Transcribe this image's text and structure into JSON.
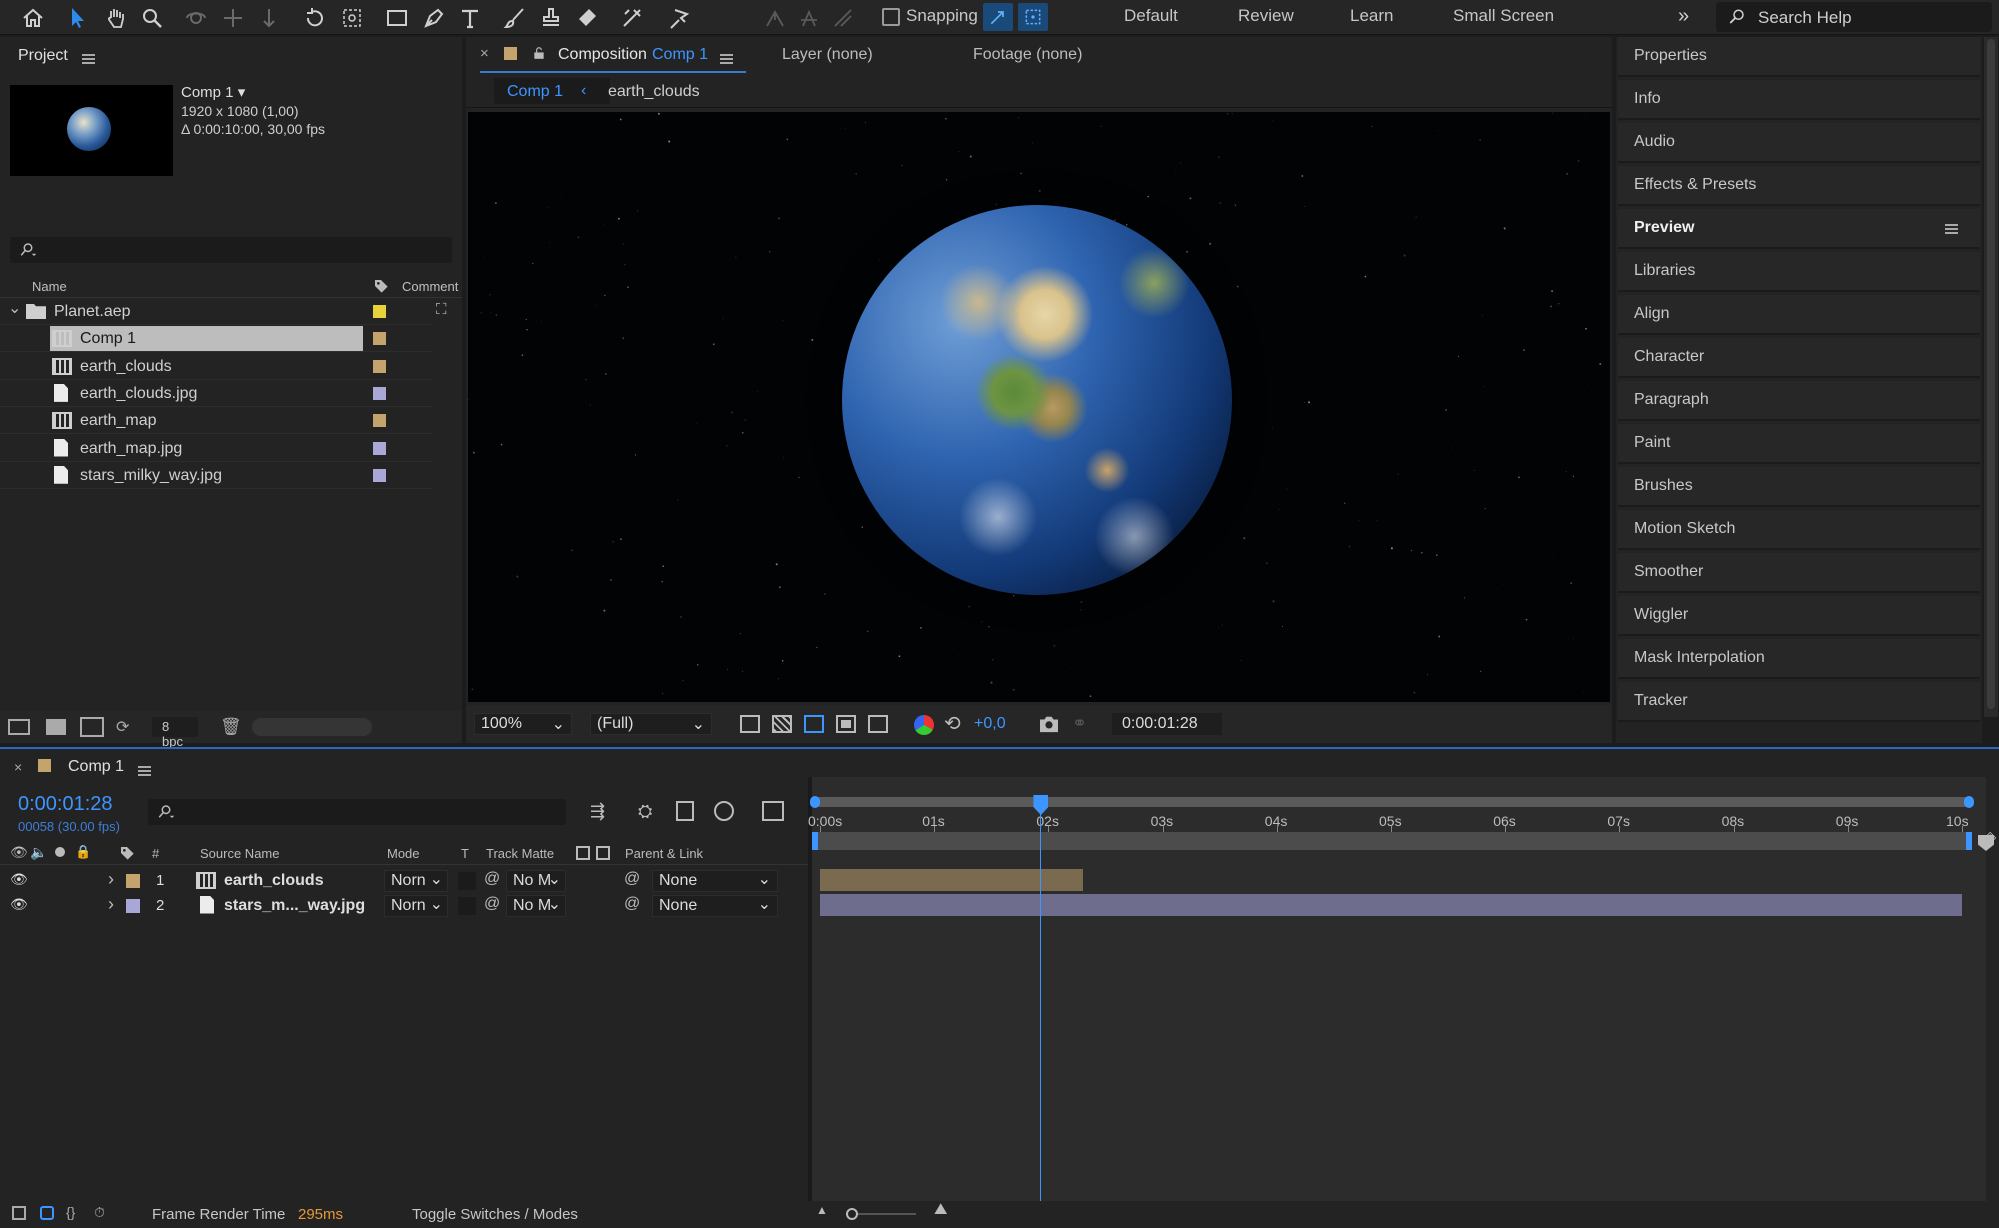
{
  "toolbar": {
    "snapping_label": "Snapping",
    "workspaces": [
      "Default",
      "Review",
      "Learn",
      "Small Screen"
    ],
    "search_placeholder": "Search Help",
    "colors": {
      "active_tool": "#2d8ceb",
      "accent": "#2d8ceb"
    }
  },
  "project": {
    "title": "Project",
    "comp_name": "Comp 1",
    "comp_size": "1920 x 1080 (1,00)",
    "comp_duration": "Δ 0:00:10:00, 30,00 fps",
    "col_name": "Name",
    "col_comment": "Comment",
    "items": [
      {
        "label": "Planet.aep",
        "type": "folder",
        "swatch": "#e8d13a"
      },
      {
        "label": "Comp 1",
        "type": "comp",
        "swatch": "#c4a46c",
        "selected": true
      },
      {
        "label": "earth_clouds",
        "type": "comp",
        "swatch": "#c4a46c"
      },
      {
        "label": "earth_clouds.jpg",
        "type": "file",
        "swatch": "#a9a6d8"
      },
      {
        "label": "earth_map",
        "type": "comp",
        "swatch": "#c4a46c"
      },
      {
        "label": "earth_map.jpg",
        "type": "file",
        "swatch": "#a9a6d8"
      },
      {
        "label": "stars_milky_way.jpg",
        "type": "file",
        "swatch": "#a9a6d8"
      }
    ],
    "bpc": "8 bpc"
  },
  "viewer": {
    "tab_composition": "Composition",
    "tab_comp_name": "Comp 1",
    "tab_layer": "Layer (none)",
    "tab_footage": "Footage (none)",
    "breadcrumb_active": "Comp 1",
    "breadcrumb_next": "earth_clouds",
    "zoom": "100%",
    "resolution": "(Full)",
    "exposure": "+0,0",
    "timecode": "0:00:01:28"
  },
  "right_panels": {
    "items": [
      "Properties",
      "Info",
      "Audio",
      "Effects & Presets",
      "Preview",
      "Libraries",
      "Align",
      "Character",
      "Paragraph",
      "Paint",
      "Brushes",
      "Motion Sketch",
      "Smoother",
      "Wiggler",
      "Mask Interpolation",
      "Tracker"
    ],
    "active": "Preview"
  },
  "timeline": {
    "comp_name": "Comp 1",
    "timecode": "0:00:01:28",
    "frame_info": "00058 (30.00 fps)",
    "headers": {
      "num": "#",
      "source": "Source Name",
      "mode": "Mode",
      "t": "T",
      "track_matte": "Track Matte",
      "parent": "Parent & Link"
    },
    "layers": [
      {
        "num": "1",
        "name": "earth_clouds",
        "type": "comp",
        "swatch": "#c4a46c",
        "mode": "Norn",
        "matte": "No M",
        "parent": "None",
        "bar_color": "#7a6a4f",
        "bar_end_seconds": 2.3
      },
      {
        "num": "2",
        "name": "stars_m..._way.jpg",
        "type": "file",
        "swatch": "#a9a6d8",
        "mode": "Norn",
        "matte": "No M",
        "parent": "None",
        "bar_color": "#6f6d8d",
        "bar_end_seconds": 10
      }
    ],
    "ruler": [
      "0:00s",
      "01s",
      "02s",
      "03s",
      "04s",
      "05s",
      "06s",
      "07s",
      "08s",
      "09s",
      "10s"
    ],
    "playhead_seconds": 1.93,
    "footer_label": "Frame Render Time",
    "footer_value": "295ms",
    "toggle_label": "Toggle Switches / Modes"
  }
}
